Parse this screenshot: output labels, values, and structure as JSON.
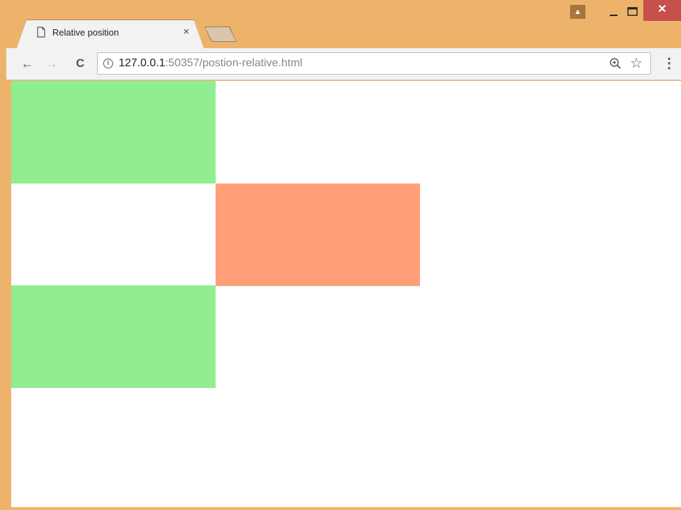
{
  "tab": {
    "title": "Relative position",
    "close_glyph": "×",
    "icon": "page-icon"
  },
  "window_controls": {
    "profile_glyph": "▲",
    "close_glyph": "✕"
  },
  "toolbar": {
    "back_glyph": "←",
    "forward_glyph": "→",
    "reload_glyph": "C",
    "info_glyph": "i",
    "url_host": "127.0.0.1",
    "url_rest": ":50357/postion-relative.html",
    "star_glyph": "☆",
    "menu_glyph": "⋮"
  },
  "colors": {
    "frame": "#eeb36a",
    "green_box": "#90ee90",
    "orange_box": "#ffa07a",
    "close_button": "#c7504a"
  },
  "page": {
    "boxes": [
      {
        "name": "green-box-1",
        "color": "lightgreen"
      },
      {
        "name": "orange-box-relative",
        "color": "lightsalmon"
      },
      {
        "name": "green-box-2",
        "color": "lightgreen"
      }
    ]
  }
}
